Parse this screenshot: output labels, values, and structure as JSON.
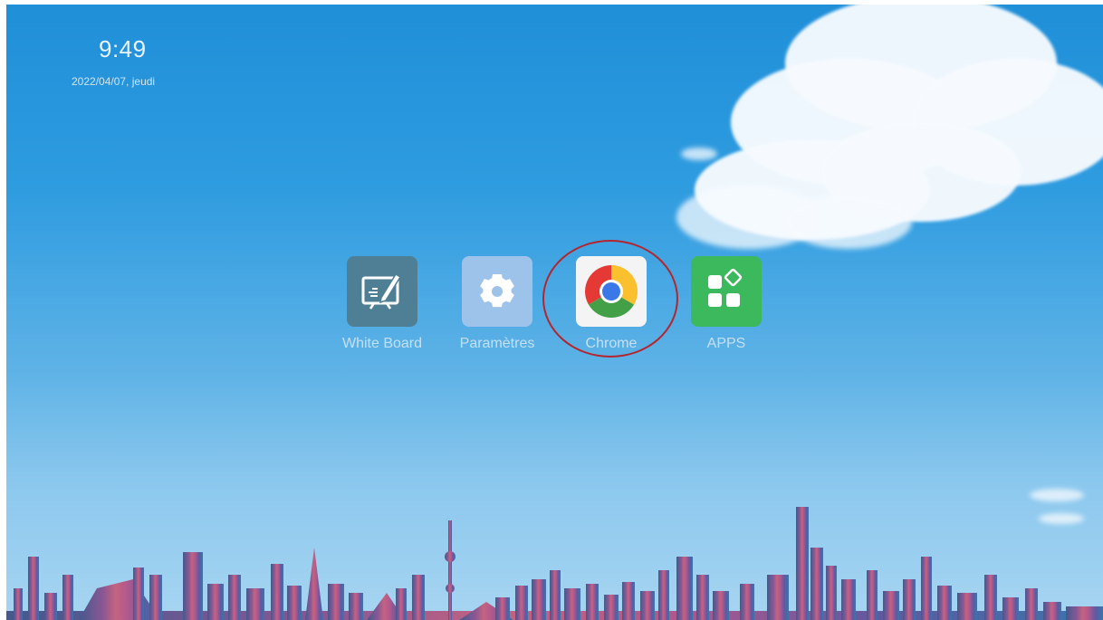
{
  "status": {
    "time": "9:49",
    "date": "2022/04/07, jeudi"
  },
  "apps": [
    {
      "label": "White Board",
      "icon": "whiteboard-icon",
      "color": "#4f7f95"
    },
    {
      "label": "Paramètres",
      "icon": "gear-icon",
      "color": "#9ec3ea"
    },
    {
      "label": "Chrome",
      "icon": "chrome-icon",
      "color": "#f4f4f4",
      "highlighted": true
    },
    {
      "label": "APPS",
      "icon": "apps-grid-icon",
      "color": "#3db95d"
    }
  ],
  "colors": {
    "highlight_ring": "#b3262e",
    "sky_top": "#1f8fd8",
    "sky_bottom": "#a7d5f1"
  }
}
